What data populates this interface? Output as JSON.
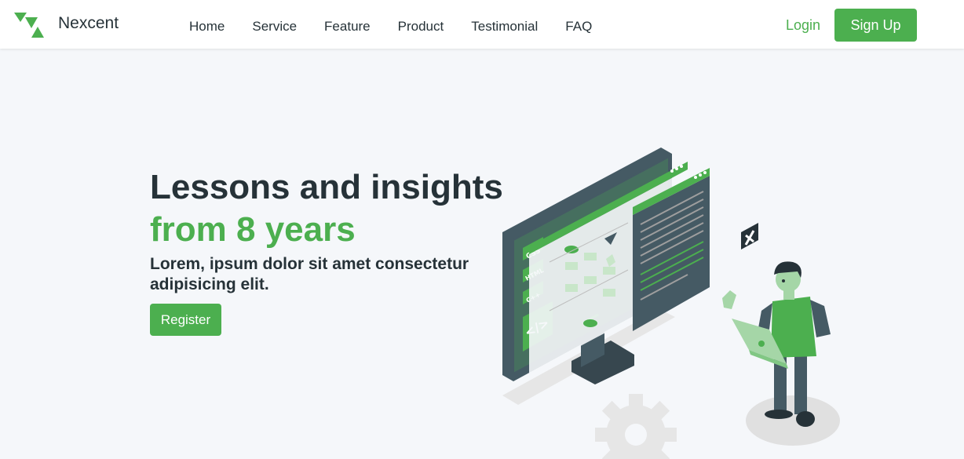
{
  "brand": {
    "name": "Nexcent"
  },
  "nav": {
    "links": [
      "Home",
      "Service",
      "Feature",
      "Product",
      "Testimonial",
      "FAQ"
    ],
    "login_label": "Login",
    "signup_label": "Sign Up"
  },
  "hero": {
    "title_line1": "Lessons and insights",
    "title_line2": "from 8 years",
    "subtitle": "Lorem, ipsum dolor sit amet consectetur adipisicing elit.",
    "register_label": "Register",
    "illustration_labels": [
      "CSS",
      "HTML",
      "C++"
    ]
  },
  "colors": {
    "primary": "#4caf4f",
    "text_dark": "#263238",
    "background": "#f5f7fa",
    "slate": "#455a64"
  }
}
